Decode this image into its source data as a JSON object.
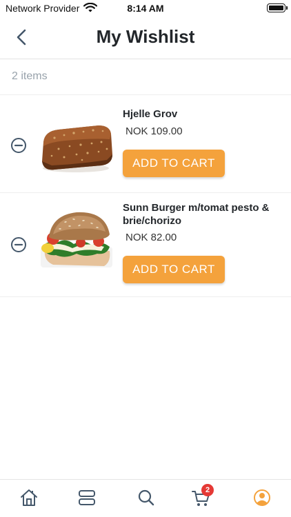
{
  "status_bar": {
    "carrier": "Network Provider",
    "time": "8:14 AM"
  },
  "header": {
    "title": "My Wishlist",
    "back_icon": "chevron-left-icon"
  },
  "wishlist": {
    "count_label": "2 items",
    "items": [
      {
        "name": "Hjelle Grov",
        "price": "NOK 109.00",
        "button_label": "ADD TO CART",
        "image": "bread-loaf"
      },
      {
        "name": "Sunn Burger m/tomat pesto & brie/chorizo",
        "price": "NOK 82.00",
        "button_label": "ADD TO CART",
        "image": "burger"
      }
    ]
  },
  "tabbar": {
    "tabs": [
      "home-icon",
      "categories-icon",
      "search-icon",
      "cart-icon",
      "account-icon"
    ],
    "cart_badge": "2",
    "active_color": "#f4a23c",
    "inactive_color": "#44576a"
  },
  "colors": {
    "accent": "#f4a23c",
    "badge": "#e53935",
    "muted_text": "#98a2ab"
  }
}
